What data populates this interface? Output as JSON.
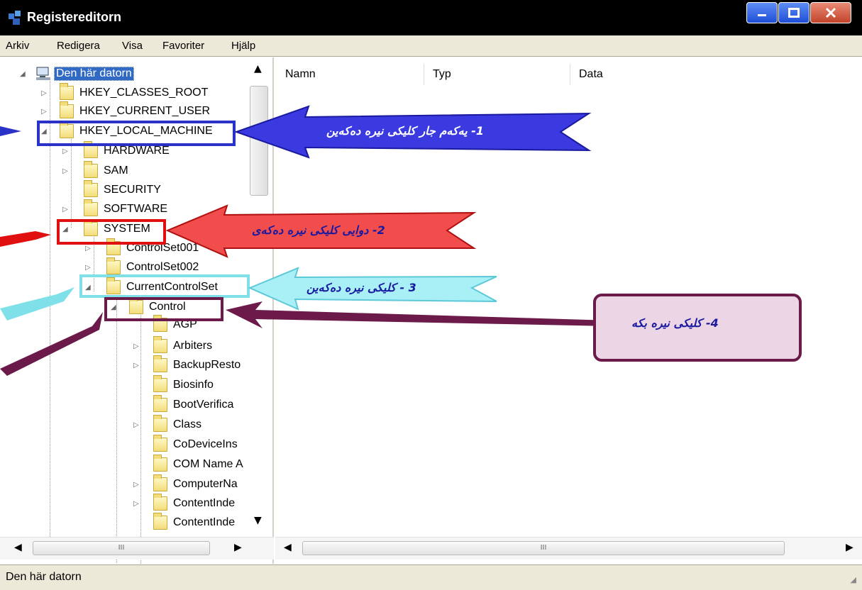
{
  "window": {
    "title": "Registereditorn",
    "icon": "regedit-icon"
  },
  "menu": [
    "Arkiv",
    "Redigera",
    "Visa",
    "Favoriter",
    "Hjälp"
  ],
  "tree": {
    "root": "Den här datorn",
    "items": [
      "HKEY_CLASSES_ROOT",
      "HKEY_CURRENT_USER",
      "HKEY_LOCAL_MACHINE",
      "HARDWARE",
      "SAM",
      "SECURITY",
      "SOFTWARE",
      "SYSTEM",
      "ControlSet001",
      "ControlSet002",
      "CurrentControlSet",
      "Control",
      "AGP",
      "Arbiters",
      "BackupResto",
      "Biosinfo",
      "BootVerifica",
      "Class",
      "CoDeviceIns",
      "COM Name A",
      "ComputerNa",
      "ContentInde",
      "ContentInde"
    ]
  },
  "list": {
    "columns": [
      "Namn",
      "Typ",
      "Data"
    ]
  },
  "scroll": {
    "grip": "III"
  },
  "status": "Den här datorn",
  "annotations": [
    "1- یەکەم جار کلیکی نیرە دەکەین",
    "2- دوایی کلیکی نیرە دەکەی",
    "3 - کلیکی نیرە دەکەین",
    "4- کلیکی نیرە بکە"
  ],
  "colors": {
    "blue": "#2a32c8",
    "red": "#e01010",
    "cyan": "#7fe0ea",
    "purple": "#6b1a4a"
  }
}
